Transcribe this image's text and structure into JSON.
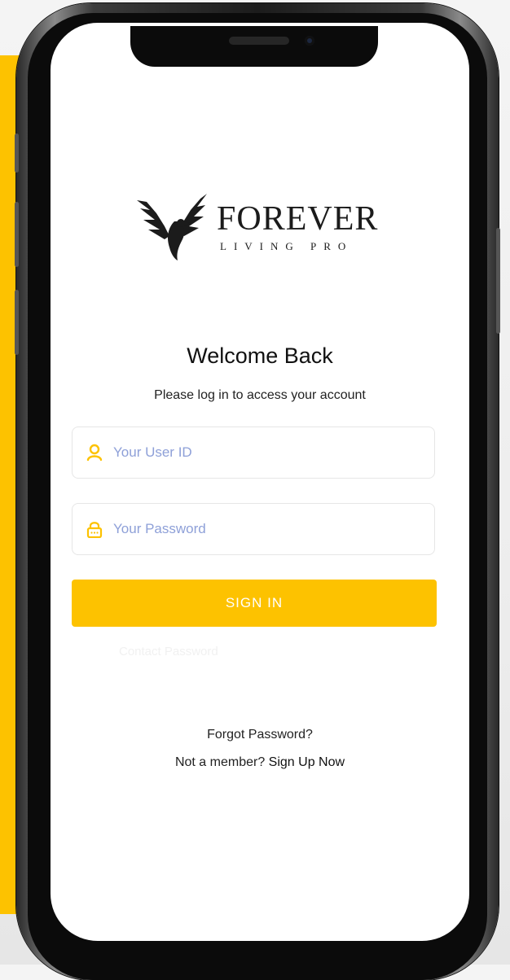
{
  "brand": {
    "name": "FOREVER",
    "tagline": "LIVING PRO"
  },
  "login": {
    "title": "Welcome Back",
    "subtitle": "Please log in to access your account",
    "user_id_placeholder": "Your User ID",
    "password_placeholder": "Your Password",
    "sign_in_label": "SIGN IN",
    "faint_text": "Contact Password",
    "forgot_password": "Forgot Password?",
    "not_member": "Not a member?",
    "sign_up": "Sign Up Now"
  },
  "icons": {
    "user": "user-icon",
    "lock": "lock-icon",
    "logo": "eagle-icon"
  },
  "colors": {
    "accent": "#FDC200",
    "placeholder": "#8ea0d8",
    "background": "#ffffff"
  }
}
